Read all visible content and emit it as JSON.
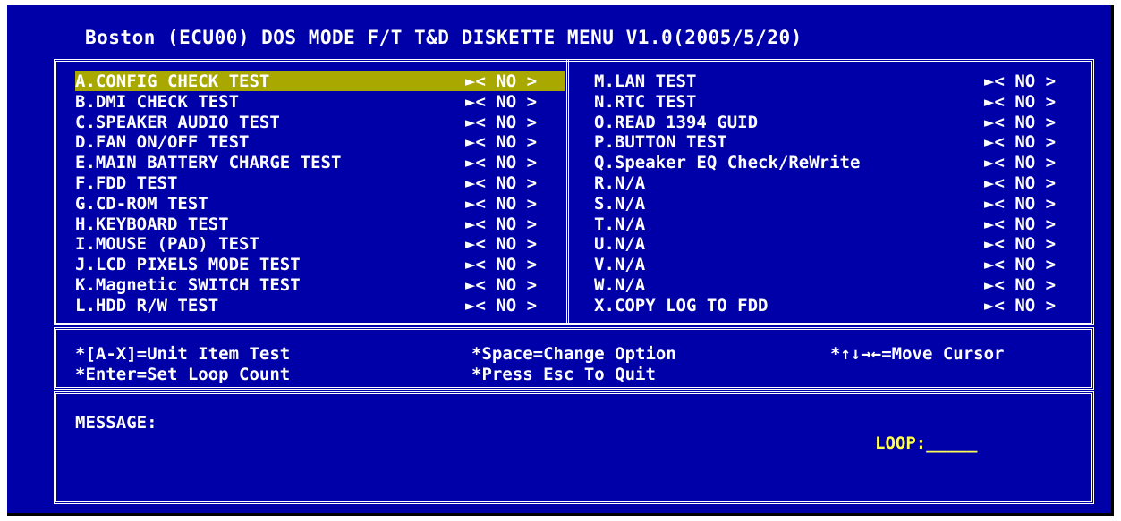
{
  "title": "Boston (ECU00) DOS MODE F/T T&D DISKETTE MENU V1.0(2005/5/20)",
  "left_items": [
    {
      "label": "A.CONFIG CHECK TEST",
      "option": "►< NO >",
      "selected": true
    },
    {
      "label": "B.DMI CHECK TEST",
      "option": "►< NO >"
    },
    {
      "label": "C.SPEAKER AUDIO TEST",
      "option": "►< NO >"
    },
    {
      "label": "D.FAN ON/OFF TEST",
      "option": "►< NO >"
    },
    {
      "label": "E.MAIN BATTERY CHARGE TEST",
      "option": "►< NO >"
    },
    {
      "label": "F.FDD TEST",
      "option": "►< NO >"
    },
    {
      "label": "G.CD-ROM TEST",
      "option": "►< NO >"
    },
    {
      "label": "H.KEYBOARD TEST",
      "option": "►< NO >"
    },
    {
      "label": "I.MOUSE (PAD) TEST",
      "option": "►< NO >"
    },
    {
      "label": "J.LCD PIXELS MODE TEST",
      "option": "►< NO >"
    },
    {
      "label": "K.Magnetic SWITCH TEST",
      "option": "►< NO >"
    },
    {
      "label": "L.HDD R/W TEST",
      "option": "►< NO >"
    }
  ],
  "right_items": [
    {
      "label": "M.LAN TEST",
      "option": "►< NO >"
    },
    {
      "label": "N.RTC TEST",
      "option": "►< NO >"
    },
    {
      "label": "O.READ 1394 GUID",
      "option": "►< NO >"
    },
    {
      "label": "P.BUTTON TEST",
      "option": "►< NO >"
    },
    {
      "label": "Q.Speaker EQ Check/ReWrite",
      "option": "►< NO >"
    },
    {
      "label": "R.N/A",
      "option": "►< NO >"
    },
    {
      "label": "S.N/A",
      "option": "►< NO >"
    },
    {
      "label": "T.N/A",
      "option": "►< NO >"
    },
    {
      "label": "U.N/A",
      "option": "►< NO >"
    },
    {
      "label": "V.N/A",
      "option": "►< NO >"
    },
    {
      "label": "W.N/A",
      "option": "►< NO >"
    },
    {
      "label": "X.COPY LOG TO FDD",
      "option": "►< NO >"
    }
  ],
  "help": {
    "unit_item": "*[A-X]=Unit Item Test",
    "space": "*Space=Change Option",
    "move": "*↑↓→←=Move Cursor",
    "enter": "*Enter=Set Loop Count",
    "esc": "*Press Esc To Quit"
  },
  "message": {
    "label": "MESSAGE:"
  },
  "loop": {
    "label": "LOOP:_____"
  },
  "colors": {
    "background": "#0000a8",
    "text": "#ffffff",
    "highlight": "#a8a800",
    "loop": "#ffff54"
  }
}
